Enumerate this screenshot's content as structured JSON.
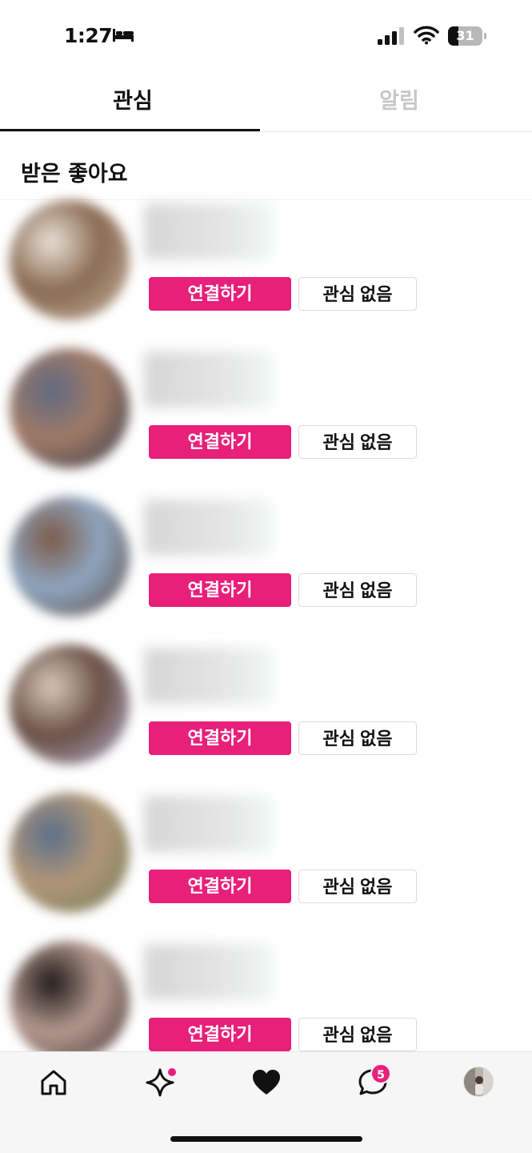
{
  "status_bar": {
    "time": "1:27",
    "battery": "31",
    "battery_level": 0.31,
    "icons": [
      "bed-icon",
      "cellular-signal-icon",
      "wifi-icon",
      "battery-icon"
    ]
  },
  "tabs": [
    {
      "label": "관심",
      "active": true
    },
    {
      "label": "알림",
      "active": false
    }
  ],
  "section_title": "받은 좋아요",
  "like_items": [
    {
      "connect_label": "연결하기",
      "dismiss_label": "관심 없음",
      "avatar_colors": [
        "#c9b7a4",
        "#8a6a52",
        "#e8e2d8"
      ]
    },
    {
      "connect_label": "연결하기",
      "dismiss_label": "관심 없음",
      "avatar_colors": [
        "#2f3548",
        "#a07a66",
        "#606a82"
      ]
    },
    {
      "connect_label": "연결하기",
      "dismiss_label": "관심 없음",
      "avatar_colors": [
        "#5a463c",
        "#8fa5bf",
        "#7b5a48"
      ]
    },
    {
      "connect_label": "연결하기",
      "dismiss_label": "관심 없음",
      "avatar_colors": [
        "#b5b3d6",
        "#6b5146",
        "#d7c9bc"
      ]
    },
    {
      "connect_label": "연결하기",
      "dismiss_label": "관심 없음",
      "avatar_colors": [
        "#6f7b58",
        "#b19678",
        "#5b6f8a"
      ]
    },
    {
      "connect_label": "연결하기",
      "dismiss_label": "관심 없음",
      "avatar_colors": [
        "#3b2c2a",
        "#b59a90",
        "#1f1a1a"
      ]
    }
  ],
  "bottom_nav": {
    "items": [
      "home-icon",
      "sparkle-icon",
      "heart-icon",
      "chat-icon",
      "profile-avatar"
    ],
    "chat_badge": "5",
    "accent": "#e8207a"
  },
  "colors": {
    "accent": "#e8207a",
    "tab_inactive": "#c7c7c7",
    "text": "#111111"
  }
}
